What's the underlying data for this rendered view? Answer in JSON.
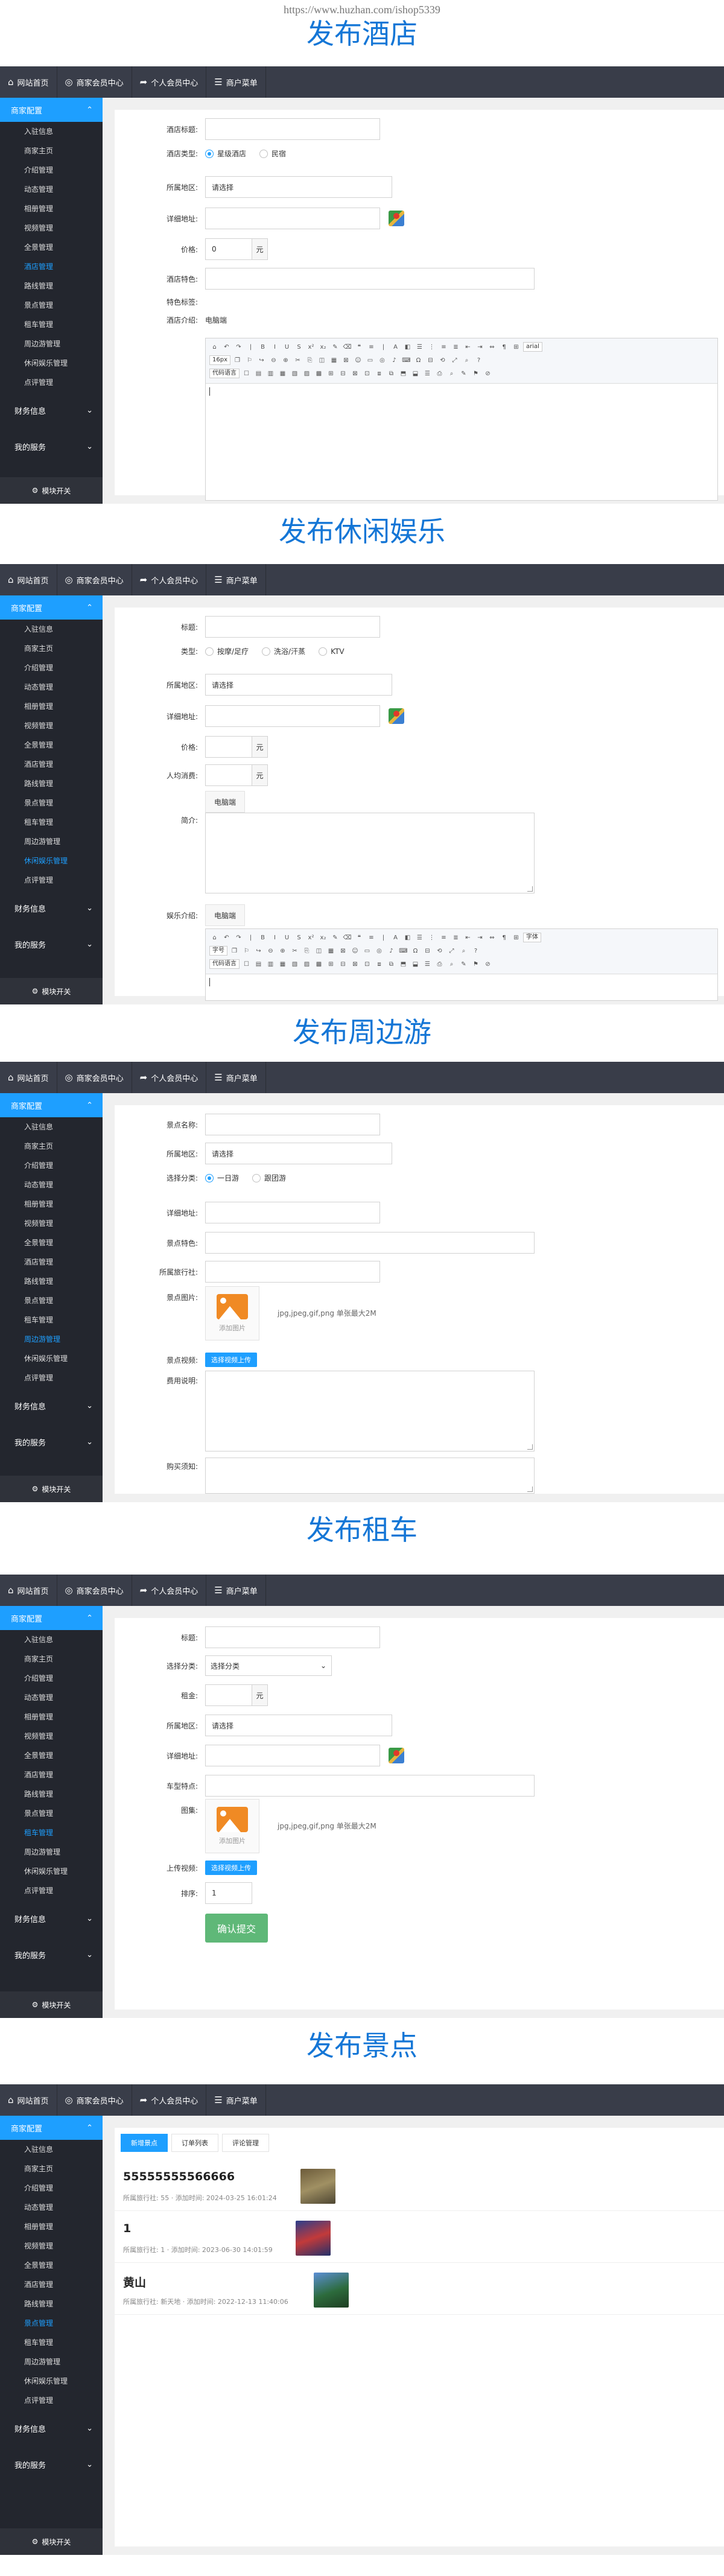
{
  "watermark_url": "https://www.huzhan.com/ishop5339",
  "nav": {
    "home": "网站首页",
    "merchant": "商家会员中心",
    "personal": "个人会员中心",
    "menu": "商户菜单"
  },
  "sidebar": {
    "group": "商家配置",
    "finance": "财务信息",
    "services": "我的服务",
    "toggle": "模块开关"
  },
  "sections": [
    {
      "title": "发布酒店",
      "menu": [
        "入驻信息",
        "商家主页",
        "介绍管理",
        "动态管理",
        "相册管理",
        "视频管理",
        "全景管理",
        "酒店管理",
        "路线管理",
        "景点管理",
        "租车管理",
        "周边游管理",
        "休闲娱乐管理",
        "点评管理"
      ],
      "active_index": 7,
      "form": {
        "hotel_title_label": "酒店标题:",
        "hotel_type_label": "酒店类型:",
        "hotel_type_options": [
          "星级酒店",
          "民宿"
        ],
        "region_label": "所属地区:",
        "region_placeholder": "请选择",
        "address_label": "详细地址:",
        "price_label": "价格:",
        "price_value": "0",
        "price_unit": "元",
        "feature_label": "酒店特色:",
        "tags_label": "特色标签:",
        "intro_label": "酒店介绍:",
        "intro_tab": "电脑端",
        "font_value": "arial",
        "size_value": "16px",
        "format_value": "代码语言"
      }
    },
    {
      "title": "发布休闲娱乐",
      "menu": [
        "入驻信息",
        "商家主页",
        "介绍管理",
        "动态管理",
        "相册管理",
        "视频管理",
        "全景管理",
        "酒店管理",
        "路线管理",
        "景点管理",
        "租车管理",
        "周边游管理",
        "休闲娱乐管理",
        "点评管理"
      ],
      "active_index": 12,
      "form": {
        "title_label": "标题:",
        "type_label": "类型:",
        "type_options": [
          "按摩/足疗",
          "洗浴/汗蒸",
          "KTV"
        ],
        "region_label": "所属地区:",
        "region_placeholder": "请选择",
        "address_label": "详细地址:",
        "price_label": "价格:",
        "price_unit": "元",
        "avg_label": "人均消费:",
        "avg_unit": "元",
        "tab": "电脑端",
        "brief_label": "简介:",
        "detail_label": "娱乐介绍:",
        "detail_tab": "电脑端",
        "font_value": "字体",
        "size_value": "字号",
        "format_value": "代码语言"
      }
    },
    {
      "title": "发布周边游",
      "menu": [
        "入驻信息",
        "商家主页",
        "介绍管理",
        "动态管理",
        "相册管理",
        "视频管理",
        "全景管理",
        "酒店管理",
        "路线管理",
        "景点管理",
        "租车管理",
        "周边游管理",
        "休闲娱乐管理",
        "点评管理"
      ],
      "active_index": 11,
      "form": {
        "name_label": "景点名称:",
        "region_label": "所属地区:",
        "region_placeholder": "请选择",
        "category_label": "选择分类:",
        "category_options": [
          "一日游",
          "跟团游"
        ],
        "address_label": "详细地址:",
        "feature_label": "景点特色:",
        "agency_label": "所属旅行社:",
        "image_label": "景点图片:",
        "image_add": "添加图片",
        "image_hint": "jpg,jpeg,gif,png  单张最大2M",
        "video_label": "景点视频:",
        "video_button": "选择视频上传",
        "fee_label": "费用说明:",
        "notice_label": "购买须知:"
      }
    },
    {
      "title": "发布租车",
      "menu": [
        "入驻信息",
        "商家主页",
        "介绍管理",
        "动态管理",
        "相册管理",
        "视频管理",
        "全景管理",
        "酒店管理",
        "路线管理",
        "景点管理",
        "租车管理",
        "周边游管理",
        "休闲娱乐管理",
        "点评管理"
      ],
      "active_index": 10,
      "form": {
        "title_label": "标题:",
        "category_label": "选择分类:",
        "category_value": "选择分类",
        "rent_label": "租金:",
        "rent_unit": "元",
        "region_label": "所属地区:",
        "region_placeholder": "请选择",
        "address_label": "详细地址:",
        "feature_label": "车型特点:",
        "image_label": "图集:",
        "image_add": "添加图片",
        "image_hint": "jpg,jpeg,gif,png  单张最大2M",
        "video_label": "上传视频:",
        "video_button": "选择视频上传",
        "sort_label": "排序:",
        "sort_value": "1",
        "submit": "确认提交"
      }
    },
    {
      "title": "发布景点",
      "menu": [
        "入驻信息",
        "商家主页",
        "介绍管理",
        "动态管理",
        "相册管理",
        "视频管理",
        "全景管理",
        "酒店管理",
        "路线管理",
        "景点管理",
        "租车管理",
        "周边游管理",
        "休闲娱乐管理",
        "点评管理"
      ],
      "active_index": 9,
      "tabs": [
        "新增景点",
        "订单列表",
        "评论管理"
      ],
      "items": [
        {
          "name": "55555555566666",
          "meta": "所属旅行社: 55  ·  添加时间: 2024-03-25 16:01:24"
        },
        {
          "name": "1",
          "meta": "所属旅行社: 1  ·  添加时间: 2023-06-30 14:01:59"
        },
        {
          "name": "黄山",
          "meta": "所属旅行社: 新天地  ·  添加时间: 2022-12-13 11:40:06"
        }
      ]
    }
  ]
}
